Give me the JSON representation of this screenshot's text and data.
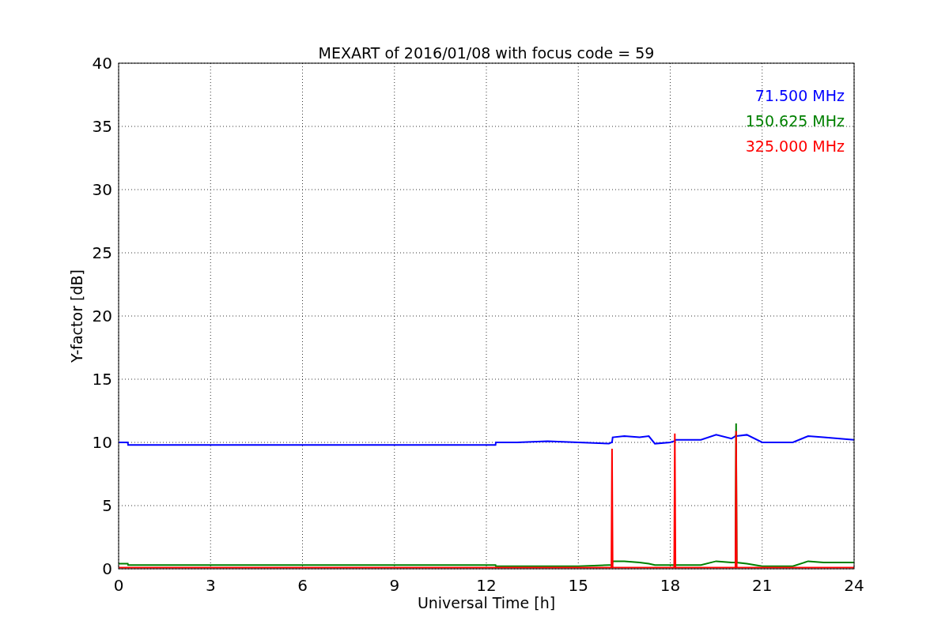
{
  "chart_data": {
    "type": "line",
    "title": "MEXART of 2016/01/08 with focus code = 59",
    "xlabel": "Universal Time [h]",
    "ylabel": "Y-factor [dB]",
    "x": [
      0,
      0.3,
      0.31,
      12.3,
      12.31,
      13,
      14,
      15,
      16,
      16.08,
      16.1,
      16.12,
      16.5,
      17,
      17.3,
      17.5,
      18,
      18.13,
      18.15,
      18.17,
      18.5,
      19,
      19.5,
      20,
      20.13,
      20.15,
      20.17,
      20.5,
      21,
      21.5,
      22,
      22.5,
      23,
      24
    ],
    "series": [
      {
        "name": "71.500 MHz",
        "color": "#0000ff",
        "values": [
          10.0,
          10.0,
          9.8,
          9.8,
          10.0,
          10.0,
          10.1,
          10.0,
          9.9,
          10.0,
          10.0,
          10.4,
          10.5,
          10.4,
          10.5,
          9.9,
          10.0,
          10.1,
          10.1,
          10.2,
          10.2,
          10.2,
          10.6,
          10.3,
          10.5,
          10.6,
          10.5,
          10.6,
          10.0,
          10.0,
          10.0,
          10.5,
          10.4,
          10.2
        ]
      },
      {
        "name": "150.625 MHz",
        "color": "#008000",
        "values": [
          0.4,
          0.4,
          0.3,
          0.3,
          0.2,
          0.2,
          0.2,
          0.2,
          0.3,
          0.3,
          0.3,
          0.6,
          0.6,
          0.5,
          0.4,
          0.3,
          0.3,
          0.3,
          0.3,
          0.3,
          0.3,
          0.3,
          0.6,
          0.5,
          0.5,
          11.5,
          0.5,
          0.4,
          0.2,
          0.2,
          0.2,
          0.6,
          0.5,
          0.5
        ]
      },
      {
        "name": "325.000 MHz",
        "color": "#ff0000",
        "values": [
          0.1,
          0.1,
          0.1,
          0.1,
          0.1,
          0.1,
          0.1,
          0.1,
          0.1,
          0.1,
          9.5,
          0.1,
          0.1,
          0.1,
          0.1,
          0.1,
          0.1,
          0.1,
          10.7,
          0.1,
          0.1,
          0.1,
          0.1,
          0.1,
          0.1,
          10.9,
          0.1,
          0.1,
          0.1,
          0.1,
          0.1,
          0.1,
          0.1,
          0.1
        ]
      }
    ],
    "xlim": [
      0,
      24
    ],
    "ylim": [
      0,
      40
    ],
    "xticks": [
      0,
      3,
      6,
      9,
      12,
      15,
      18,
      21,
      24
    ],
    "yticks": [
      0,
      5,
      10,
      15,
      20,
      25,
      30,
      35,
      40
    ],
    "grid": true
  }
}
